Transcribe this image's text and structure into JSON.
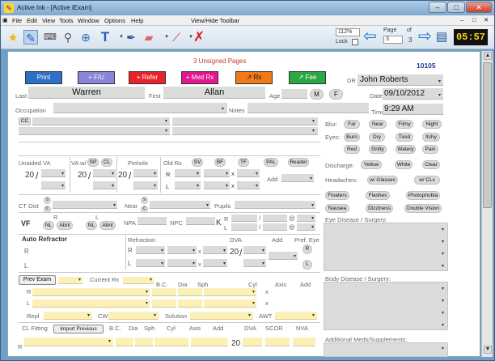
{
  "window": {
    "title": "Active Ink - [Active iExam]",
    "controls": [
      "–",
      "□",
      "✕"
    ],
    "inner_controls": [
      "–",
      "□",
      "✕"
    ]
  },
  "menu": [
    "File",
    "Edit",
    "View",
    "Tools",
    "Window",
    "Options",
    "Help"
  ],
  "menu_right": "View/Hide Toolbar",
  "toolbar": {
    "zoom": "112%",
    "lock_label": "Lock",
    "page_label": "Page",
    "page_value": "3",
    "of_label": "of",
    "total_pages": "3",
    "timer": "05:57",
    "icons": [
      "star-icon",
      "lasso-pen-icon",
      "keyboard-icon",
      "magnifier-icon",
      "zoom-region-icon",
      "text-tool-icon",
      "pen-icon",
      "eraser-icon",
      "brush-icon",
      "delete-icon"
    ]
  },
  "header": {
    "unsigned": "3 Unsigned Pages",
    "record_no": "10105"
  },
  "buttons": {
    "print": "Print",
    "fu": "+ F/U",
    "refer": "+ Refer",
    "medrx": "+ Med Rx",
    "rx": "↗ Rx",
    "fee": "↗ Fee"
  },
  "colors": {
    "print": "#2e6fc7",
    "fu": "#8a84d8",
    "refer": "#e8222a",
    "medrx": "#e3168e",
    "rx": "#f07a1a",
    "fee": "#2aa845"
  },
  "patient": {
    "dr_label": "DR",
    "dr_value": "John Roberts",
    "last_label": "Last",
    "last_value": "Warren",
    "first_label": "First",
    "first_value": "Allan",
    "age_label": "Age",
    "sex_m": "M",
    "sex_f": "F",
    "date_label": "Date",
    "date_value": "09/10/2012",
    "occupation_label": "Occupation",
    "notes_label": "Notes",
    "time_label": "Time",
    "time_value": "9:29 AM",
    "cc": "CC"
  },
  "symptoms": {
    "blur_label": "Blur:",
    "blur": [
      "Far",
      "Near",
      "Filmy",
      "Night"
    ],
    "eyes_label": "Eyes:",
    "eyes1": [
      "Burn",
      "Dry",
      "Tired",
      "Itchy"
    ],
    "eyes2": [
      "Red",
      "Gritty",
      "Watery",
      "Pain"
    ],
    "discharge_label": "Discharge:",
    "discharge": [
      "Yellow",
      "White",
      "Clear"
    ],
    "headaches_label": "Headaches:",
    "headaches": [
      "w/ Glasses",
      "w/ CLs"
    ],
    "row1": [
      "Floaters",
      "Flashes",
      "Photophobia"
    ],
    "row2": [
      "Nausea",
      "Dizziness",
      "Double Vision"
    ]
  },
  "va": {
    "unaided": "Unaided VA",
    "vaw": "VA w/",
    "sp": "SP",
    "cl": "CL",
    "pinhole": "Pinhole",
    "oldrx": "Old Rx",
    "sv": "SV",
    "bf": "BF",
    "tf": "TF",
    "pal": "PAL",
    "reader": "Reader",
    "twenty": "20",
    "slash": "/",
    "r": "R",
    "l": "L",
    "x": "x",
    "add": "Add"
  },
  "dist": {
    "ct_dist": "CT Dist",
    "s": "s",
    "c": "c",
    "near": "Near",
    "pupils": "Pupils",
    "vf": "VF",
    "r": "R",
    "l": "L",
    "nl": "NL",
    "abnl": "Abnl",
    "npa": "NPA",
    "npc": "NPC",
    "k": "K",
    "at": "@"
  },
  "refraction": {
    "auto": "Auto Refractor",
    "refraction": "Refraction",
    "dva": "DVA",
    "add": "Add",
    "pref_eye": "Pref. Eye",
    "r": "R",
    "l": "L"
  },
  "eye_disease": "Eye Disease / Surgery:",
  "body_disease": "Body Disease / Surgery:",
  "addl_meds": "Additional Meds/Supplements:",
  "prev": {
    "prev_exam": "Prev Exam",
    "current_rx": "Current Rx",
    "bc": "B.C.",
    "dia": "Dia",
    "sph": "Sph",
    "cyl": "Cyl",
    "axis": "Axis",
    "add": "Add",
    "r": "R",
    "l": "L",
    "x": "x",
    "repl": "Repl",
    "cw": "CW",
    "solution": "Solution",
    "awt": "AWT"
  },
  "cl": {
    "cl_fitting": "CL Fitting",
    "import_prev": "Import Previous",
    "bc": "B.C.",
    "dia": "Dia",
    "sph": "Sph",
    "cyl": "Cyl",
    "axis": "Axis",
    "add": "Add",
    "dva": "DVA",
    "scor": "SCOR",
    "nva": "NVA",
    "twenty": "20"
  }
}
